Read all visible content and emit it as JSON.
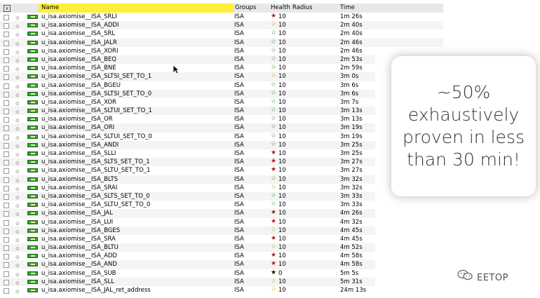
{
  "header": {
    "close_symbol": "x",
    "name": "Name",
    "groups": "Groups",
    "health": "Health",
    "radius": "Radius",
    "time": "Time"
  },
  "rows": [
    {
      "name": "u_isa.axiomise__ISA_SRLI",
      "group": "ISA",
      "star": "red",
      "health": "10",
      "time": "1m 26s"
    },
    {
      "name": "u_isa.axiomise__ISA_ADDI",
      "group": "ISA",
      "star": "yellow",
      "health": "10",
      "time": "2m 40s"
    },
    {
      "name": "u_isa.axiomise__ISA_SRL",
      "group": "ISA",
      "star": "green",
      "health": "10",
      "time": "2m 40s"
    },
    {
      "name": "u_isa.axiomise__ISA_JALR",
      "group": "ISA",
      "star": "green",
      "health": "10",
      "time": "2m 46s"
    },
    {
      "name": "u_isa.axiomise__ISA_XORI",
      "group": "ISA",
      "star": "green",
      "health": "10",
      "time": "2m 46s"
    },
    {
      "name": "u_isa.axiomise__ISA_BEQ",
      "group": "ISA",
      "star": "green",
      "health": "10",
      "time": "2m 53s"
    },
    {
      "name": "u_isa.axiomise__ISA_BNE",
      "group": "ISA",
      "star": "green",
      "health": "10",
      "time": "2m 59s"
    },
    {
      "name": "u_isa.axiomise__ISA_SLTSI_SET_TO_1",
      "group": "ISA",
      "star": "yellow",
      "health": "10",
      "time": "3m 0s"
    },
    {
      "name": "u_isa.axiomise__ISA_BGEU",
      "group": "ISA",
      "star": "green",
      "health": "10",
      "time": "3m 6s"
    },
    {
      "name": "u_isa.axiomise__ISA_SLTSI_SET_TO_0",
      "group": "ISA",
      "star": "green",
      "health": "10",
      "time": "3m 6s"
    },
    {
      "name": "u_isa.axiomise__ISA_XOR",
      "group": "ISA",
      "star": "green",
      "health": "10",
      "time": "3m 7s"
    },
    {
      "name": "u_isa.axiomise__ISA_SLTUI_SET_TO_1",
      "group": "ISA",
      "star": "green",
      "health": "10",
      "time": "3m 13s"
    },
    {
      "name": "u_isa.axiomise__ISA_OR",
      "group": "ISA",
      "star": "green",
      "health": "10",
      "time": "3m 13s"
    },
    {
      "name": "u_isa.axiomise__ISA_ORI",
      "group": "ISA",
      "star": "green",
      "health": "10",
      "time": "3m 19s"
    },
    {
      "name": "u_isa.axiomise__ISA_SLTUI_SET_TO_0",
      "group": "ISA",
      "star": "green",
      "health": "10",
      "time": "3m 19s"
    },
    {
      "name": "u_isa.axiomise__ISA_ANDI",
      "group": "ISA",
      "star": "green",
      "health": "10",
      "time": "3m 25s"
    },
    {
      "name": "u_isa.axiomise__ISA_SLLI",
      "group": "ISA",
      "star": "red",
      "health": "10",
      "time": "3m 25s"
    },
    {
      "name": "u_isa.axiomise__ISA_SLTS_SET_TO_1",
      "group": "ISA",
      "star": "red",
      "health": "10",
      "time": "3m 27s"
    },
    {
      "name": "u_isa.axiomise__ISA_SLTU_SET_TO_1",
      "group": "ISA",
      "star": "red",
      "health": "10",
      "time": "3m 27s"
    },
    {
      "name": "u_isa.axiomise__ISA_BLTS",
      "group": "ISA",
      "star": "green",
      "health": "10",
      "time": "3m 32s"
    },
    {
      "name": "u_isa.axiomise__ISA_SRAI",
      "group": "ISA",
      "star": "yellow",
      "health": "10",
      "time": "3m 32s"
    },
    {
      "name": "u_isa.axiomise__ISA_SLTS_SET_TO_0",
      "group": "ISA",
      "star": "green",
      "health": "10",
      "time": "3m 33s"
    },
    {
      "name": "u_isa.axiomise__ISA_SLTU_SET_TO_0",
      "group": "ISA",
      "star": "green",
      "health": "10",
      "time": "3m 33s"
    },
    {
      "name": "u_isa.axiomise__ISA_JAL",
      "group": "ISA",
      "star": "red",
      "health": "10",
      "time": "4m 26s"
    },
    {
      "name": "u_isa.axiomise__ISA_LUI",
      "group": "ISA",
      "star": "red",
      "health": "10",
      "time": "4m 32s"
    },
    {
      "name": "u_isa.axiomise__ISA_BGES",
      "group": "ISA",
      "star": "yellow",
      "health": "10",
      "time": "4m 45s"
    },
    {
      "name": "u_isa.axiomise__ISA_SRA",
      "group": "ISA",
      "star": "red",
      "health": "10",
      "time": "4m 45s"
    },
    {
      "name": "u_isa.axiomise__ISA_BLTU",
      "group": "ISA",
      "star": "yellow",
      "health": "10",
      "time": "4m 52s"
    },
    {
      "name": "u_isa.axiomise__ISA_ADD",
      "group": "ISA",
      "star": "red",
      "health": "10",
      "time": "4m 58s"
    },
    {
      "name": "u_isa.axiomise__ISA_AND",
      "group": "ISA",
      "star": "red",
      "health": "10",
      "time": "4m 58s"
    },
    {
      "name": "u_isa.axiomise__ISA_SUB",
      "group": "ISA",
      "star": "black",
      "health": "0",
      "time": "5m 5s"
    },
    {
      "name": "u_isa.axiomise__ISA_SLL",
      "group": "ISA",
      "star": "yellow",
      "health": "10",
      "time": "5m 31s"
    },
    {
      "name": "u_isa.axiomise__ISA_JAL_ret_address",
      "group": "ISA",
      "star": "yellow",
      "health": "10",
      "time": "24m 13s"
    }
  ],
  "callout": {
    "text": "~50% exhaustively proven in less than 30 min!"
  },
  "watermark": {
    "text": "EETOP",
    "logo_icon": "wechat-icon"
  }
}
